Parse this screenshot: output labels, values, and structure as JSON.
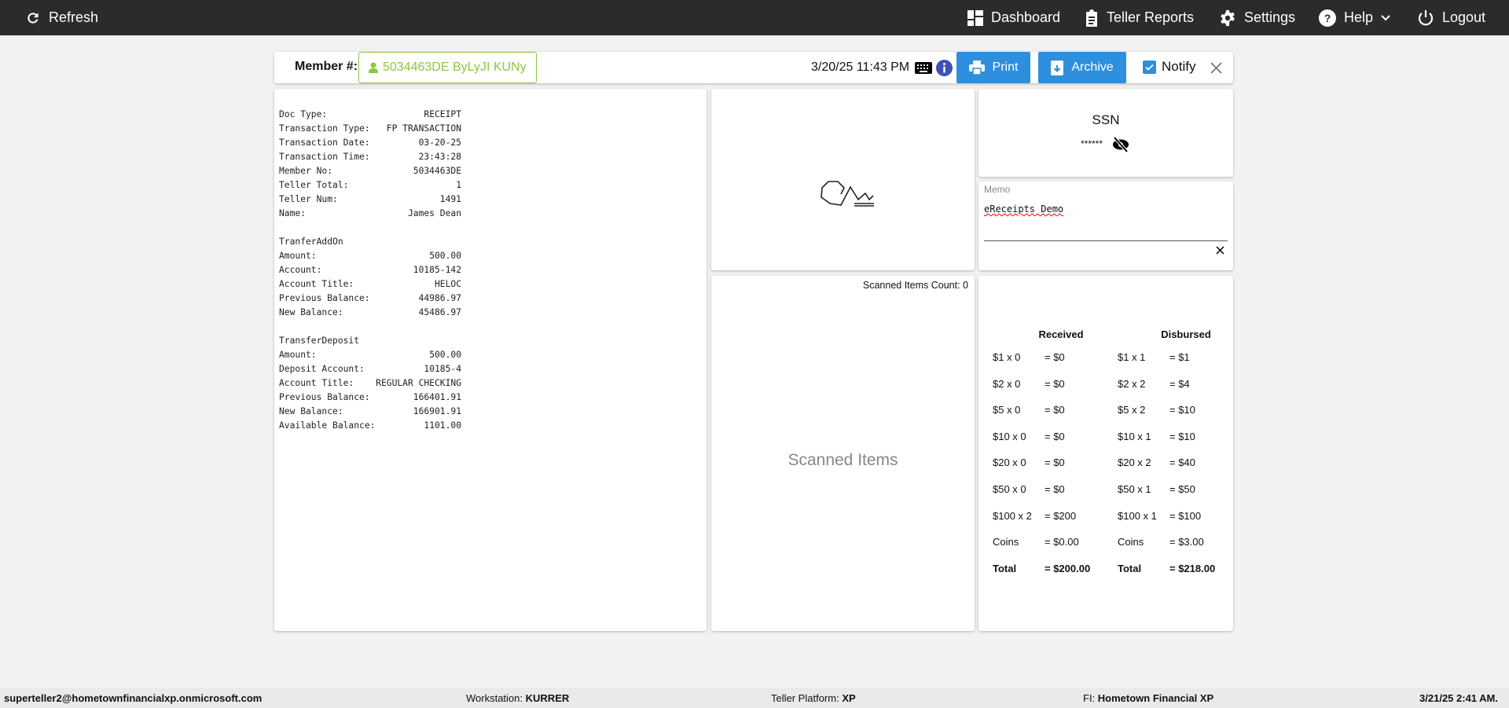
{
  "topbar": {
    "refresh": "Refresh",
    "nav": [
      {
        "label": "Dashboard",
        "icon": "dashboard-icon"
      },
      {
        "label": "Teller Reports",
        "icon": "clipboard-icon"
      },
      {
        "label": "Settings",
        "icon": "gear-icon"
      },
      {
        "label": "Help",
        "icon": "question-circle-icon"
      },
      {
        "label": "Logout",
        "icon": "power-icon"
      }
    ]
  },
  "toolbar": {
    "member_label": "Member #:",
    "member_value": "5034463DE ByLyJI KUNy",
    "datetime": "3/20/25 11:43 PM",
    "print": "Print",
    "archive": "Archive",
    "notify": "Notify",
    "notify_checked": true
  },
  "receipt": {
    "header": [
      [
        "Doc Type:",
        "RECEIPT"
      ],
      [
        "Transaction Type:",
        "FP TRANSACTION"
      ],
      [
        "Transaction Date:",
        "03-20-25"
      ],
      [
        "Transaction Time:",
        "23:43:28"
      ],
      [
        "Member No:",
        "5034463DE"
      ],
      [
        "Teller Total:",
        "1"
      ],
      [
        "Teller Num:",
        "1491"
      ],
      [
        "Name:",
        "James Dean"
      ]
    ],
    "sections": [
      {
        "title": "TranferAddOn",
        "rows": [
          [
            "Amount:",
            "500.00"
          ],
          [
            "Account:",
            "10185-142"
          ],
          [
            "Account Title:",
            "HELOC"
          ],
          [
            "Previous Balance:",
            "44986.97"
          ],
          [
            "New Balance:",
            "45486.97"
          ]
        ]
      },
      {
        "title": "TransferDeposit",
        "rows": [
          [
            "Amount:",
            "500.00"
          ],
          [
            "Deposit Account:",
            "10185-4"
          ],
          [
            "Account Title:",
            "REGULAR CHECKING"
          ],
          [
            "Previous Balance:",
            "166401.91"
          ],
          [
            "New Balance:",
            "166901.91"
          ],
          [
            "Available Balance:",
            "1101.00"
          ]
        ]
      }
    ]
  },
  "scanned": {
    "count_label": "Scanned Items Count: 0",
    "placeholder": "Scanned Items"
  },
  "ssn": {
    "title": "SSN",
    "masked": "******"
  },
  "memo": {
    "label": "Memo",
    "value": "eReceipts Demo"
  },
  "cash": {
    "received_title": "Received",
    "disbursed_title": "Disbursed",
    "received": [
      [
        "$1 x 0",
        "= $0"
      ],
      [
        "$2 x 0",
        "= $0"
      ],
      [
        "$5 x 0",
        "= $0"
      ],
      [
        "$10 x 0",
        "= $0"
      ],
      [
        "$20 x 0",
        "= $0"
      ],
      [
        "$50 x 0",
        "= $0"
      ],
      [
        "$100 x 2",
        "= $200"
      ],
      [
        "Coins",
        "= $0.00"
      ],
      [
        "Total",
        "= $200.00"
      ]
    ],
    "disbursed": [
      [
        "$1 x 1",
        "= $1"
      ],
      [
        "$2 x 2",
        "= $4"
      ],
      [
        "$5 x 2",
        "= $10"
      ],
      [
        "$10 x 1",
        "= $10"
      ],
      [
        "$20 x 2",
        "= $40"
      ],
      [
        "$50 x 1",
        "= $50"
      ],
      [
        "$100 x 1",
        "= $100"
      ],
      [
        "Coins",
        "= $3.00"
      ],
      [
        "Total",
        "= $218.00"
      ]
    ]
  },
  "footer": {
    "user": "superteller2@hometownfinancialxp.onmicrosoft.com",
    "workstation_label": "Workstation:",
    "workstation": "KURRER",
    "platform_label": "Teller Platform:",
    "platform": "XP",
    "fi_label": "FI:",
    "fi": "Hometown Financial XP",
    "datetime": "3/21/25 2:41 AM."
  },
  "colors": {
    "topbar": "#2b2b2b",
    "button": "#2d8fdd",
    "member": "#8dc63f"
  }
}
